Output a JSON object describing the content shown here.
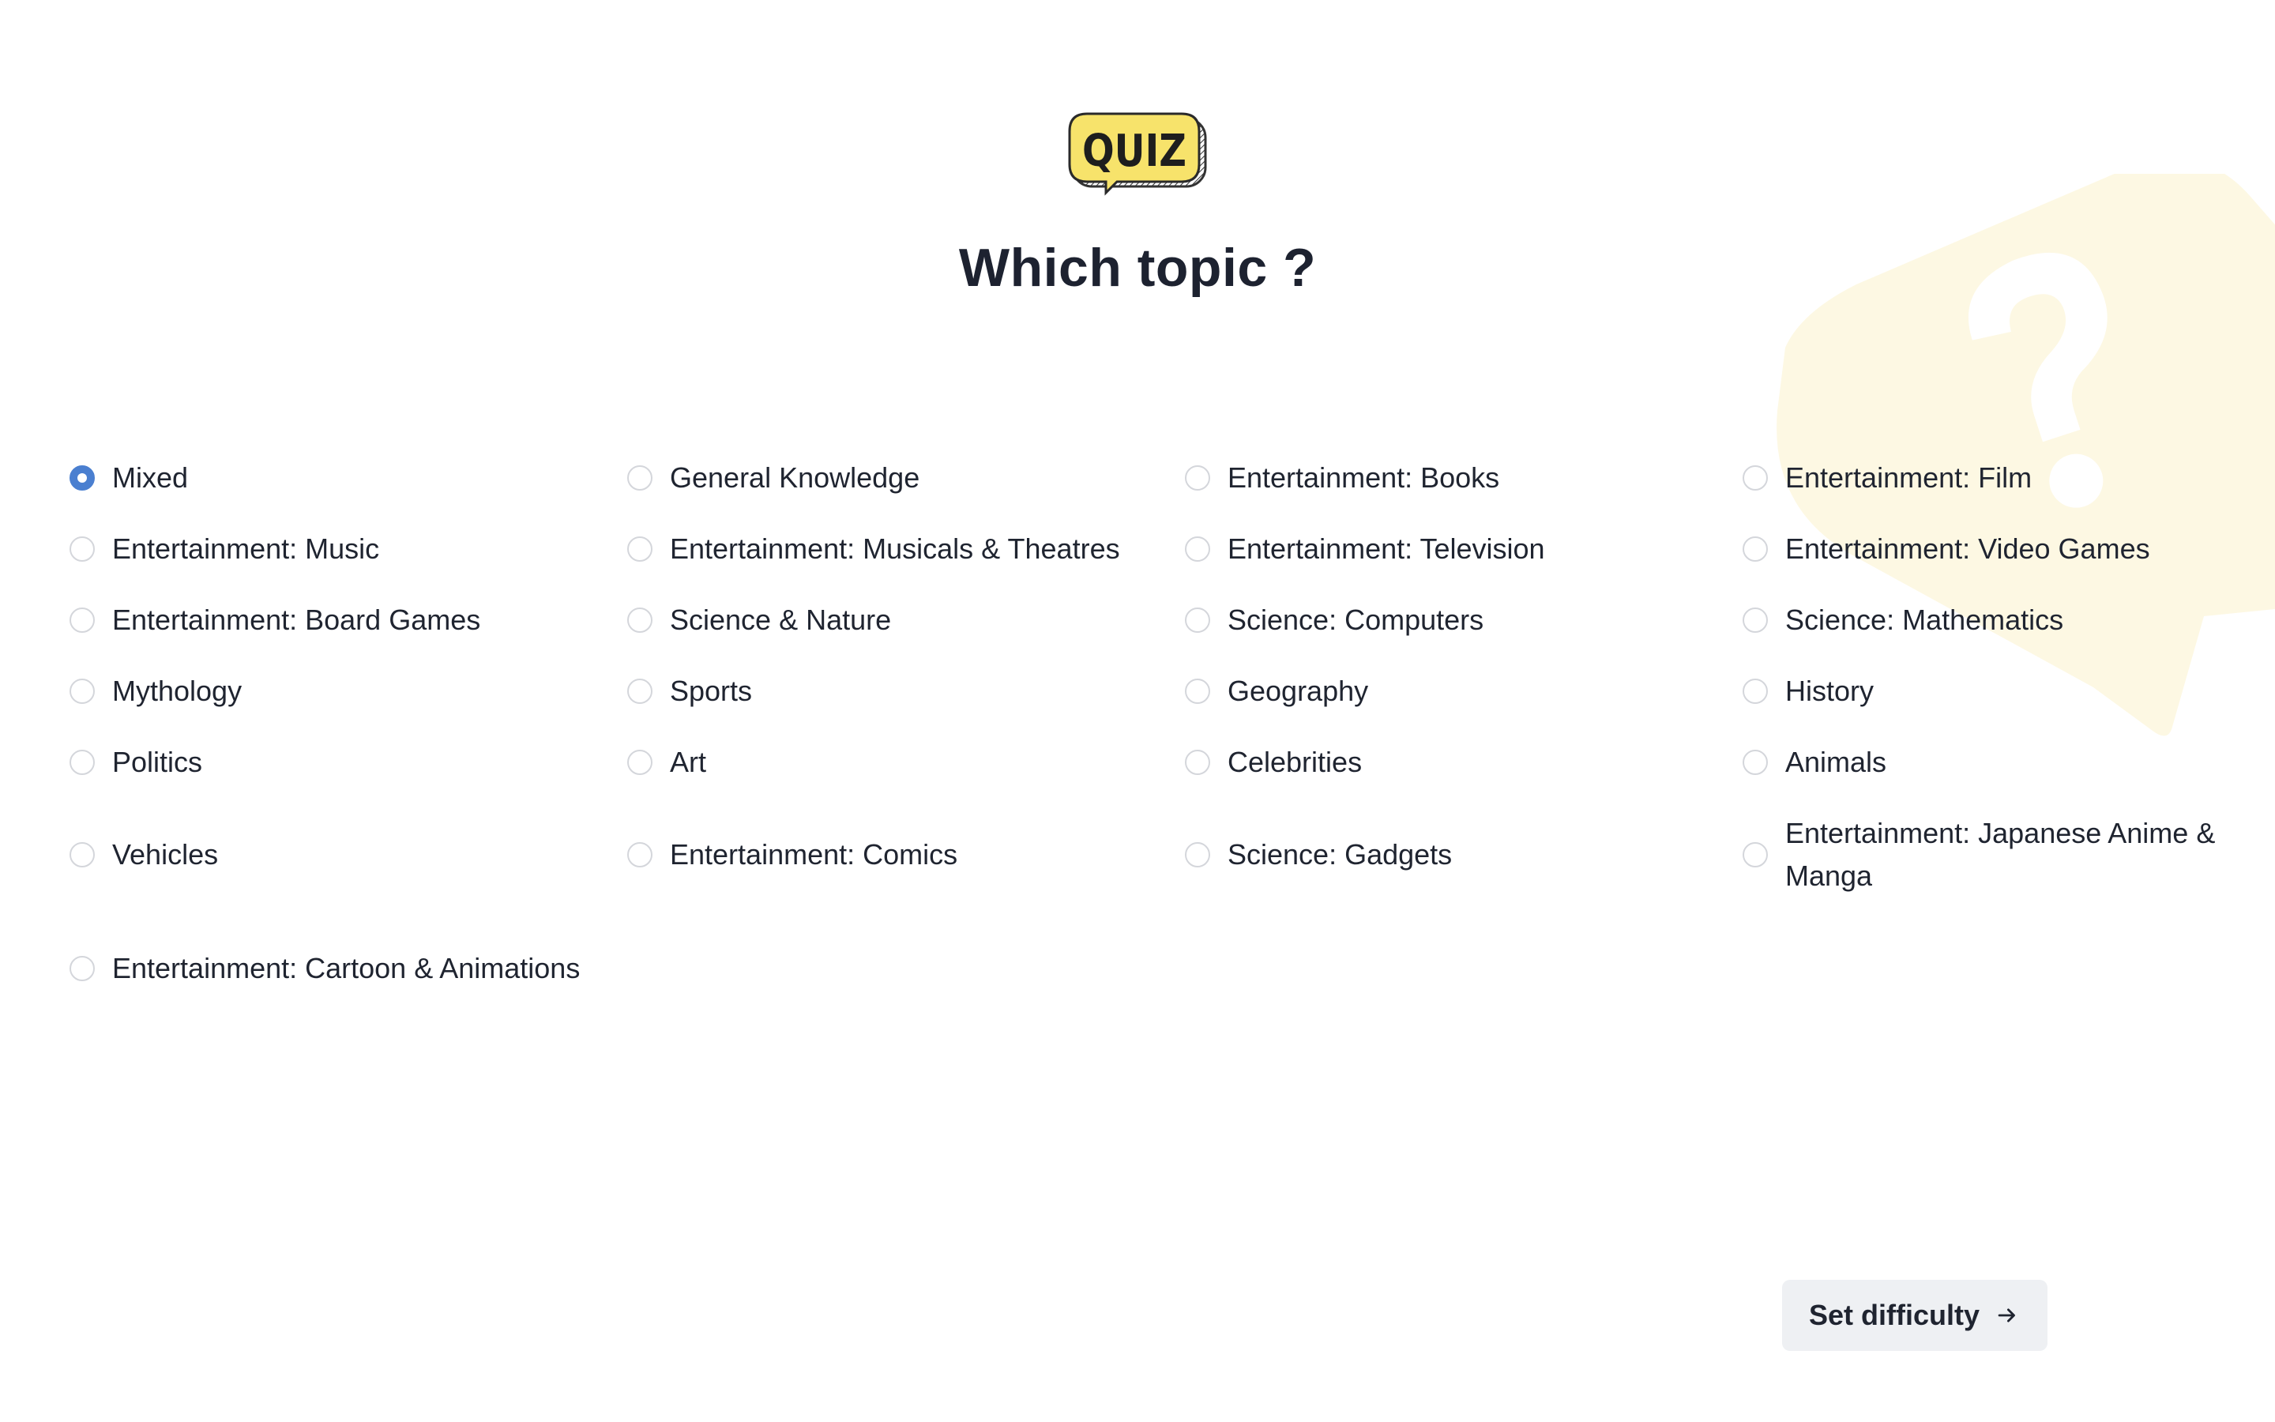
{
  "logo": {
    "text": "QUIZ"
  },
  "page": {
    "title": "Which topic ?"
  },
  "topics": [
    {
      "label": "Mixed",
      "selected": true
    },
    {
      "label": "General Knowledge",
      "selected": false
    },
    {
      "label": "Entertainment: Books",
      "selected": false
    },
    {
      "label": "Entertainment: Film",
      "selected": false
    },
    {
      "label": "Entertainment: Music",
      "selected": false
    },
    {
      "label": "Entertainment: Musicals & Theatres",
      "selected": false
    },
    {
      "label": "Entertainment: Television",
      "selected": false
    },
    {
      "label": "Entertainment: Video Games",
      "selected": false
    },
    {
      "label": "Entertainment: Board Games",
      "selected": false
    },
    {
      "label": "Science & Nature",
      "selected": false
    },
    {
      "label": "Science: Computers",
      "selected": false
    },
    {
      "label": "Science: Mathematics",
      "selected": false
    },
    {
      "label": "Mythology",
      "selected": false
    },
    {
      "label": "Sports",
      "selected": false
    },
    {
      "label": "Geography",
      "selected": false
    },
    {
      "label": "History",
      "selected": false
    },
    {
      "label": "Politics",
      "selected": false
    },
    {
      "label": "Art",
      "selected": false
    },
    {
      "label": "Celebrities",
      "selected": false
    },
    {
      "label": "Animals",
      "selected": false
    },
    {
      "label": "Vehicles",
      "selected": false
    },
    {
      "label": "Entertainment: Comics",
      "selected": false
    },
    {
      "label": "Science: Gadgets",
      "selected": false
    },
    {
      "label": "Entertainment: Japanese Anime & Manga",
      "selected": false
    },
    {
      "label": "Entertainment: Cartoon & Animations",
      "selected": false
    }
  ],
  "footer": {
    "next_label": "Set difficulty",
    "next_icon": "arrow-right-icon"
  },
  "colors": {
    "accent": "#4a7fd0",
    "logo_yellow": "#f7e36b",
    "background_bubble": "#fdf8e3",
    "button_bg": "#eef0f3",
    "text": "#1f2430"
  }
}
